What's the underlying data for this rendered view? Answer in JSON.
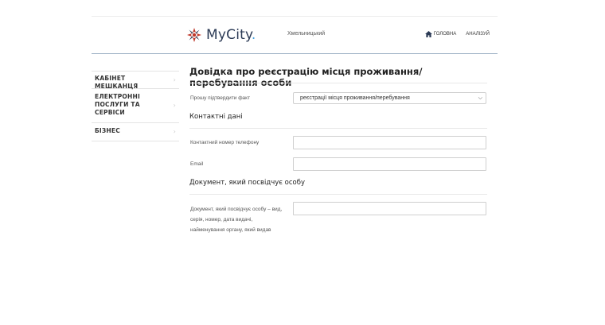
{
  "header": {
    "logo_text": "MyCity",
    "logo_dot": ".",
    "city": "Хмельницький",
    "nav": [
      {
        "label": "головна",
        "icon": "home-icon"
      },
      {
        "label": "аналізуй"
      }
    ]
  },
  "sidebar": {
    "items": [
      {
        "label": "Кабінет мешканця"
      },
      {
        "label": "Електронні послуги та сервіси"
      },
      {
        "label": "Бізнес"
      }
    ]
  },
  "main": {
    "title": "Довідка про реєстрацію місця проживання/перебування особи",
    "confirm": {
      "label": "Прошу підтвердити факт",
      "selected": "реєстрації місця проживання/перебування"
    },
    "contacts": {
      "title": "Контактні дані",
      "phone_label": "Контактний номер телефону",
      "phone_value": "",
      "email_label": "Email",
      "email_value": ""
    },
    "document": {
      "title": "Документ, який посвідчує особу",
      "doc_label": "Документ, який посвідчує особу – вид, серія, номер, дата видачі, найменування органу, який видав",
      "doc_value": ""
    }
  },
  "colors": {
    "logo_text": "#2b3a55",
    "logo_accent": "#4aa3df",
    "logo_mark": "#c0392b",
    "header_rule": "#9fb3c6"
  }
}
